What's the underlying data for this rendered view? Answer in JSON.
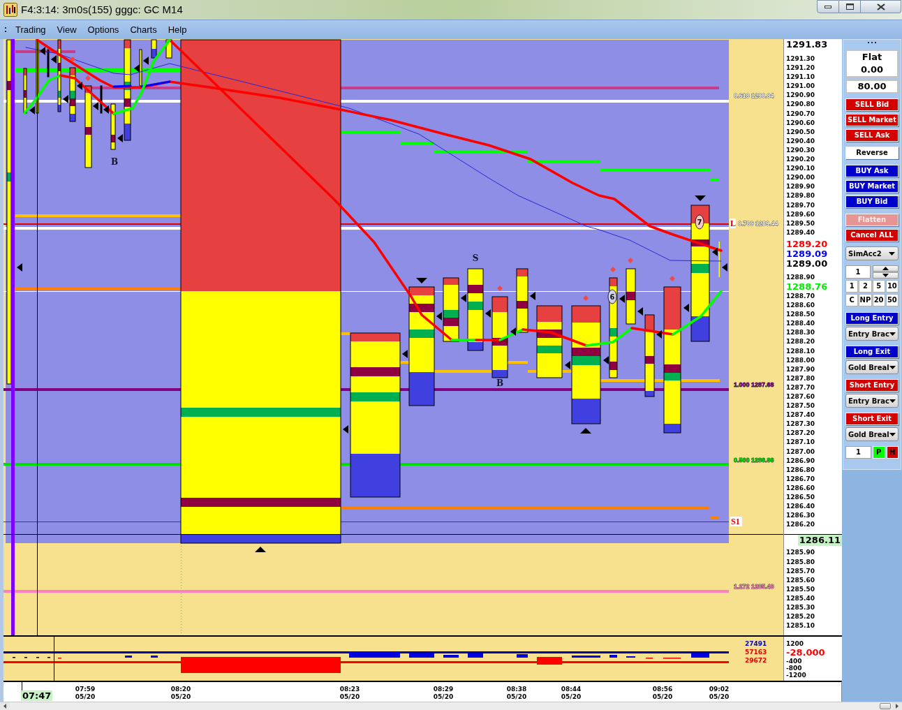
{
  "window": {
    "title": "F4:3:14: 3m0s(155) gggc: GC M14"
  },
  "menu": [
    "Trading",
    "View",
    "Options",
    "Charts",
    "Help"
  ],
  "chart": {
    "levels": [
      {
        "label": "0.618 1290.84",
        "kind": "fib",
        "color": "#ffffff"
      },
      {
        "label": "L",
        "kind": "pivot",
        "color": "#e00000"
      },
      {
        "label": "0.786 1289.44",
        "kind": "fib",
        "color": "#ffffff"
      },
      {
        "label": "1.000 1287.68",
        "kind": "fib",
        "color": "#800080"
      },
      {
        "label": "0.500 1286.86",
        "kind": "fib",
        "color": "#00e000"
      },
      {
        "label": "S1",
        "kind": "pivot",
        "color": "#e00000"
      },
      {
        "label": "1.272 1285.48",
        "kind": "fib",
        "color": "#ff80c0"
      }
    ],
    "signals": [
      {
        "text": "B"
      },
      {
        "text": "S"
      },
      {
        "text": "B"
      }
    ],
    "badges": [
      {
        "text": "6"
      },
      {
        "text": "7"
      }
    ]
  },
  "price_axis": {
    "labels": [
      {
        "text": "1291.83",
        "kind": "marker",
        "color": "#000000"
      },
      {
        "text": "1291.30",
        "kind": "tick"
      },
      {
        "text": "1291.20",
        "kind": "tick"
      },
      {
        "text": "1291.10",
        "kind": "tick"
      },
      {
        "text": "1291.00",
        "kind": "tick"
      },
      {
        "text": "1290.90",
        "kind": "tick"
      },
      {
        "text": "1290.80",
        "kind": "tick"
      },
      {
        "text": "1290.70",
        "kind": "tick"
      },
      {
        "text": "1290.60",
        "kind": "tick"
      },
      {
        "text": "1290.50",
        "kind": "tick"
      },
      {
        "text": "1290.40",
        "kind": "tick"
      },
      {
        "text": "1290.30",
        "kind": "tick"
      },
      {
        "text": "1290.20",
        "kind": "tick"
      },
      {
        "text": "1290.10",
        "kind": "tick"
      },
      {
        "text": "1290.00",
        "kind": "tick"
      },
      {
        "text": "1289.90",
        "kind": "tick"
      },
      {
        "text": "1289.80",
        "kind": "tick"
      },
      {
        "text": "1289.70",
        "kind": "tick"
      },
      {
        "text": "1289.60",
        "kind": "tick"
      },
      {
        "text": "1289.50",
        "kind": "tick"
      },
      {
        "text": "1289.40",
        "kind": "tick"
      },
      {
        "text": "1289.20",
        "kind": "marker",
        "color": "#ff0000"
      },
      {
        "text": "1289.09",
        "kind": "marker",
        "color": "#0000ff"
      },
      {
        "text": "1289.00",
        "kind": "marker",
        "color": "#000000"
      },
      {
        "text": "1288.90",
        "kind": "tick"
      },
      {
        "text": "1288.76",
        "kind": "marker",
        "color": "#00ee00"
      },
      {
        "text": "1288.70",
        "kind": "tick"
      },
      {
        "text": "1288.60",
        "kind": "tick"
      },
      {
        "text": "1288.50",
        "kind": "tick"
      },
      {
        "text": "1288.40",
        "kind": "tick"
      },
      {
        "text": "1288.30",
        "kind": "tick"
      },
      {
        "text": "1288.20",
        "kind": "tick"
      },
      {
        "text": "1288.10",
        "kind": "tick"
      },
      {
        "text": "1288.00",
        "kind": "tick"
      },
      {
        "text": "1287.90",
        "kind": "tick"
      },
      {
        "text": "1287.80",
        "kind": "tick"
      },
      {
        "text": "1287.70",
        "kind": "tick"
      },
      {
        "text": "1287.60",
        "kind": "tick"
      },
      {
        "text": "1287.50",
        "kind": "tick"
      },
      {
        "text": "1287.40",
        "kind": "tick"
      },
      {
        "text": "1287.30",
        "kind": "tick"
      },
      {
        "text": "1287.20",
        "kind": "tick"
      },
      {
        "text": "1287.10",
        "kind": "tick"
      },
      {
        "text": "1287.00",
        "kind": "tick"
      },
      {
        "text": "1286.90",
        "kind": "tick"
      },
      {
        "text": "1286.80",
        "kind": "tick"
      },
      {
        "text": "1286.70",
        "kind": "tick"
      },
      {
        "text": "1286.60",
        "kind": "tick"
      },
      {
        "text": "1286.50",
        "kind": "tick"
      },
      {
        "text": "1286.40",
        "kind": "tick"
      },
      {
        "text": "1286.30",
        "kind": "tick"
      },
      {
        "text": "1286.20",
        "kind": "tick"
      },
      {
        "text": "1286.11",
        "kind": "cursor"
      },
      {
        "text": "1285.90",
        "kind": "tick"
      },
      {
        "text": "1285.80",
        "kind": "tick"
      },
      {
        "text": "1285.70",
        "kind": "tick"
      },
      {
        "text": "1285.60",
        "kind": "tick"
      },
      {
        "text": "1285.50",
        "kind": "tick"
      },
      {
        "text": "1285.40",
        "kind": "tick"
      },
      {
        "text": "1285.30",
        "kind": "tick"
      },
      {
        "text": "1285.20",
        "kind": "tick"
      },
      {
        "text": "1285.10",
        "kind": "tick"
      }
    ]
  },
  "indicator": {
    "values": [
      {
        "text": "27491",
        "color": "#0000c8"
      },
      {
        "text": "57163",
        "color": "#e00000"
      },
      {
        "text": "29672",
        "color": "#e00000"
      }
    ],
    "axis": [
      {
        "text": "1200",
        "kind": "tick"
      },
      {
        "text": "-28.000",
        "kind": "marker",
        "color": "#ff0000"
      },
      {
        "text": "-400",
        "kind": "tick"
      },
      {
        "text": "-800",
        "kind": "tick"
      },
      {
        "text": "-1200",
        "kind": "tick"
      }
    ]
  },
  "time_axis": {
    "cursor": "07:47",
    "labels": [
      {
        "time": "07:59",
        "date": "05/20"
      },
      {
        "time": "08:20",
        "date": "05/20"
      },
      {
        "time": "08:23",
        "date": "05/20"
      },
      {
        "time": "08:29",
        "date": "05/20"
      },
      {
        "time": "08:38",
        "date": "05/20"
      },
      {
        "time": "08:44",
        "date": "05/20"
      },
      {
        "time": "08:56",
        "date": "05/20"
      },
      {
        "time": "09:02",
        "date": "05/20"
      }
    ]
  },
  "order_panel": {
    "position": "Flat",
    "pnl": "0.00",
    "price": "80.00",
    "groups": [
      {
        "buttons": [
          {
            "label": "SELL Bid",
            "kind": "sell",
            "disabled": false
          },
          {
            "label": "SELL Market",
            "kind": "sell",
            "disabled": false
          },
          {
            "label": "SELL Ask",
            "kind": "sell",
            "disabled": false
          }
        ]
      },
      {
        "buttons": [
          {
            "label": "Reverse",
            "kind": "plain",
            "disabled": false
          }
        ]
      },
      {
        "buttons": [
          {
            "label": "BUY Ask",
            "kind": "buy",
            "disabled": false
          },
          {
            "label": "BUY Market",
            "kind": "buy",
            "disabled": false
          },
          {
            "label": "BUY Bid",
            "kind": "buy",
            "disabled": false
          }
        ]
      },
      {
        "buttons": [
          {
            "label": "Flatten",
            "kind": "sell",
            "disabled": true
          },
          {
            "label": "Cancel ALL",
            "kind": "sell",
            "disabled": false
          }
        ]
      }
    ],
    "account": "SimAcc2",
    "quantity": "1",
    "presets": [
      "1",
      "2",
      "5",
      "10",
      "C",
      "NP",
      "20",
      "50"
    ],
    "strategies": [
      {
        "button": {
          "label": "Long Entry",
          "kind": "buy",
          "disabled": false
        },
        "dropdown": "Entry Brac"
      },
      {
        "button": {
          "label": "Long Exit",
          "kind": "buy",
          "disabled": false
        },
        "dropdown": "Gold Breal"
      },
      {
        "button": {
          "label": "Short Entry",
          "kind": "sell",
          "disabled": false
        },
        "dropdown": "Entry Brac"
      },
      {
        "button": {
          "label": "Short Exit",
          "kind": "sell",
          "disabled": false
        },
        "dropdown": "Gold Breal"
      }
    ],
    "hotkeys": {
      "quantity": "1",
      "buttons": [
        {
          "label": "P",
          "color": "#00ff00"
        },
        {
          "label": "H",
          "color": "#d00000"
        }
      ]
    }
  }
}
